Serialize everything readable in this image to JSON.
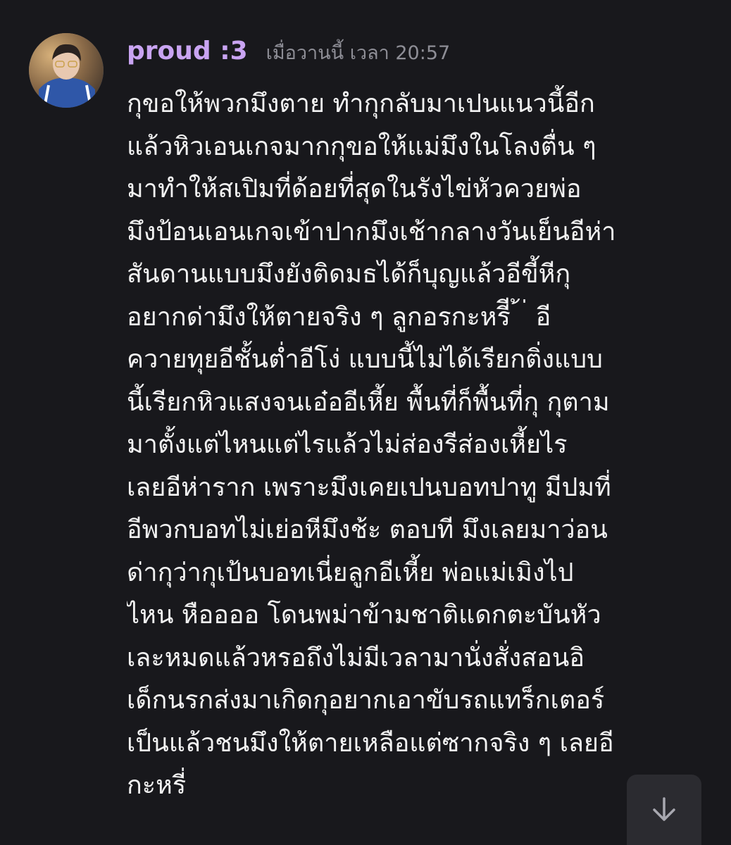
{
  "comment": {
    "author": "proud :3",
    "timestamp": "เมื่อวานนี้ เวลา 20:57",
    "lines": [
      "กุขอให้พวกมึงตาย ทำกุกลับมาเปนแนวนี้อีก",
      "แล้วหิวเอนเกจมากกุขอให้แม่มึงในโลงตื่น ๆ",
      "มาทำให้สเปิมที่ด้อยที่สุดในรังไข่หัวควยพ่อ",
      "มึงป้อนเอนเกจเข้าปากมึงเช้ากลางวันเย็นอีห่า",
      "สันดานแบบมึงยังติดมธได้ก็บุญแล้วอีขี้หีกุ",
      "อยากด่ามึงให้ตายจริง ๆ ลูกอรกะหรีี่ ้ ่ อี",
      "ควายทุยอีชั้นต่ำอีโง่ แบบนี้ไม่ได้เรียกติ่งแบบ",
      "นี้เรียกหิวแสงจนเอ๋ออีเหี้ย พื้นที่ก็พื้นที่กุ กุตาม",
      "มาตั้งแต่ไหนแต่ไรแล้วไม่ส่องรีส่องเหี้ยไร",
      "เลยอีห่าราก เพราะมึงเคยเปนบอทปาทู มีปมที่",
      "อีพวกบอทไม่เย่อหีมึงช้ะ ตอบที มึงเลยมาว่อน",
      "ด่ากุว่ากุเป้นบอทเนี่ยลูกอีเหี้ย พ่อแม่เมิงไป",
      "ไหน หืออออ โดนพม่าข้ามชาติแดกตะบันหัว",
      "เละหมดแล้วหรอถึงไม่มีเวลามานั่งสั่งสอนอิ",
      "เด็กนรกส่งมาเกิดกุอยากเอาขับรถแทร็กเตอร์",
      "เป็นแล้วชนมึงให้ตายเหลือแต่ซากจริง ๆ เลยอี",
      "กะหรี่"
    ]
  },
  "scroll_button": {
    "icon": "arrow-down-icon"
  },
  "colors": {
    "background": "#18181c",
    "username": "#c9a4f2",
    "timestamp": "#8e8e96",
    "message_text": "#f2f2f2",
    "button_bg": "#2b2b30"
  }
}
